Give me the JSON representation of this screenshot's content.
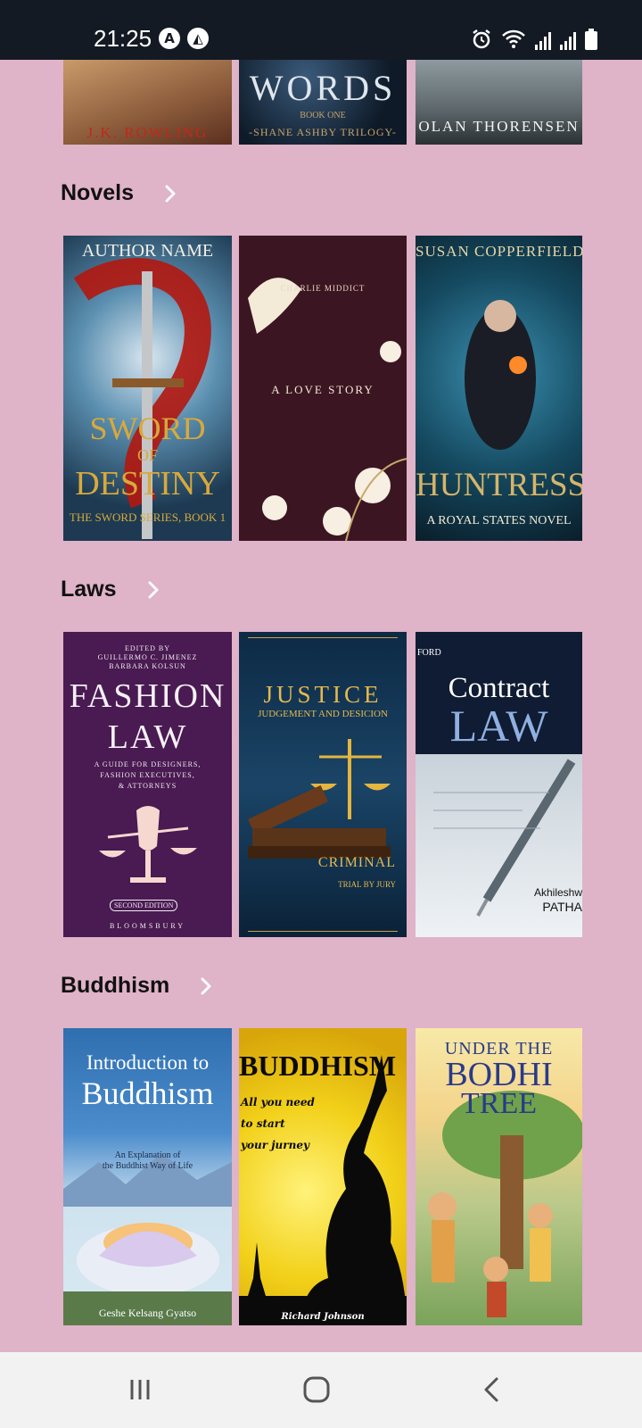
{
  "status_bar": {
    "time": "21:25"
  },
  "top_row": [
    {
      "author": "J.K. ROWLING"
    },
    {
      "title": "WORDS",
      "sub": "BOOK ONE",
      "series": "-SHANE ASHBY TRILOGY-"
    },
    {
      "author": "OLAN THORENSEN"
    }
  ],
  "sections": [
    {
      "title": "Novels",
      "books": [
        {
          "author": "AUTHOR NAME",
          "title1": "SWORD",
          "title2": "OF",
          "title3": "DESTINY",
          "series": "THE SWORD SERIES, BOOK 1"
        },
        {
          "small": "CHARLIE MIDDICT",
          "title": "A LOVE STORY"
        },
        {
          "author": "SUSAN COPPERFIELD",
          "title": "HUNTRESS",
          "series": "A ROYAL STATES NOVEL"
        }
      ]
    },
    {
      "title": "Laws",
      "books": [
        {
          "editors1": "EDITED BY",
          "editors2": "GUILLERMO C. JIMENEZ",
          "editors3": "BARBARA KOLSUN",
          "title1": "FASHION",
          "title2": "LAW",
          "sub1": "A GUIDE FOR DESIGNERS,",
          "sub2": "FASHION EXECUTIVES,",
          "sub3": "& ATTORNEYS",
          "edition": "SECOND EDITION",
          "publisher": "BLOOMSBURY"
        },
        {
          "title": "JUSTICE",
          "sub": "JUDGEMENT AND DESICION",
          "tag": "CRIMINAL",
          "tag2": "TRIAL BY JURY"
        },
        {
          "top": "FORD",
          "title1": "Contract",
          "title2": "LAW",
          "author1": "Akhileshw",
          "author2": "PATHA"
        }
      ]
    },
    {
      "title": "Buddhism",
      "books": [
        {
          "title1": "Introduction to",
          "title2": "Buddhism",
          "sub1": "An Explanation of",
          "sub2": "the Buddhist Way of Life",
          "author": "Geshe Kelsang Gyatso"
        },
        {
          "title": "BUDDHISM",
          "line1": "All you need",
          "line2": "to start",
          "line3": "your jurney",
          "author": "Richard Johnson"
        },
        {
          "title1": "UNDER THE",
          "title2": "BODHI",
          "title3": "TREE"
        }
      ]
    }
  ]
}
